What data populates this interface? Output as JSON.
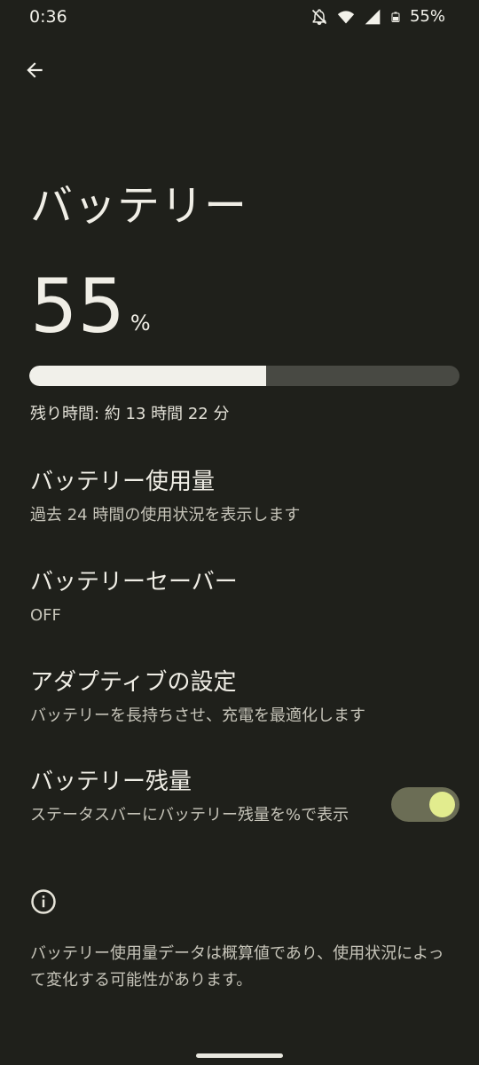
{
  "status_bar": {
    "time": "0:36",
    "battery_percent": "55%",
    "icons": [
      "notifications-off-icon",
      "wifi-icon",
      "cell-signal-icon",
      "battery-icon"
    ]
  },
  "header": {
    "back_icon": "arrow-left-icon",
    "title": "バッテリー"
  },
  "battery": {
    "percent_value": "55",
    "percent_unit": "%",
    "level_fraction": 0.55,
    "remaining": "残り時間: 約 13 時間 22 分"
  },
  "settings": [
    {
      "title": "バッテリー使用量",
      "subtitle": "過去 24 時間の使用状況を表示します"
    },
    {
      "title": "バッテリーセーバー",
      "subtitle": "OFF"
    },
    {
      "title": "アダプティブの設定",
      "subtitle": "バッテリーを長持ちさせ、充電を最適化します"
    },
    {
      "title": "バッテリー残量",
      "subtitle": "ステータスバーにバッテリー残量を%で表示",
      "toggle_on": true
    }
  ],
  "footer": {
    "info_icon": "info-icon",
    "text": "バッテリー使用量データは概算値であり、使用状況によって変化する可能性があります。"
  },
  "colors": {
    "background": "#1f201b",
    "progress_fill": "#f1f0ea",
    "progress_track": "#484943",
    "toggle_track": "#6b6d55",
    "toggle_knob": "#e2ec8e"
  }
}
